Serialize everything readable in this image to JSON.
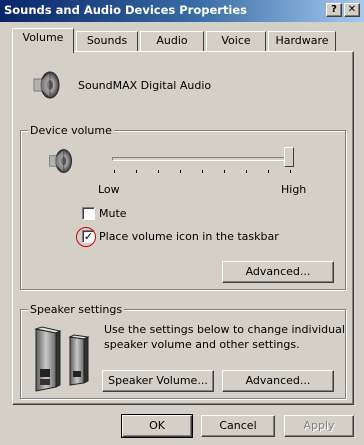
{
  "window": {
    "title": "Sounds and Audio Devices Properties",
    "help_glyph": "?",
    "close_glyph": "✕"
  },
  "tabs": [
    {
      "label": "Volume",
      "active": true
    },
    {
      "label": "Sounds",
      "active": false
    },
    {
      "label": "Audio",
      "active": false
    },
    {
      "label": "Voice",
      "active": false
    },
    {
      "label": "Hardware",
      "active": false
    }
  ],
  "device": {
    "name": "SoundMAX Digital Audio",
    "icon": "speaker-icon"
  },
  "device_volume": {
    "group_label": "Device volume",
    "icon": "speaker-icon",
    "slider_level": 1.0,
    "low_label": "Low",
    "high_label": "High",
    "mute_label": "Mute",
    "mute_checked": false,
    "taskbar_label": "Place volume icon in the taskbar",
    "taskbar_checked": true,
    "taskbar_check_glyph": "✓",
    "advanced_label": "Advanced..."
  },
  "speaker_settings": {
    "group_label": "Speaker settings",
    "icon": "speakers-icon",
    "description_line1": "Use the settings below to change individual",
    "description_line2": "speaker volume and other settings.",
    "speaker_volume_label": "Speaker Volume...",
    "advanced_label": "Advanced..."
  },
  "footer": {
    "ok_label": "OK",
    "cancel_label": "Cancel",
    "apply_label": "Apply",
    "apply_enabled": false
  },
  "colors": {
    "title_gradient_start": "#0a246a",
    "title_gradient_end": "#a6caf0",
    "face": "#d4d0c8",
    "annotation_circle": "#d00000"
  }
}
